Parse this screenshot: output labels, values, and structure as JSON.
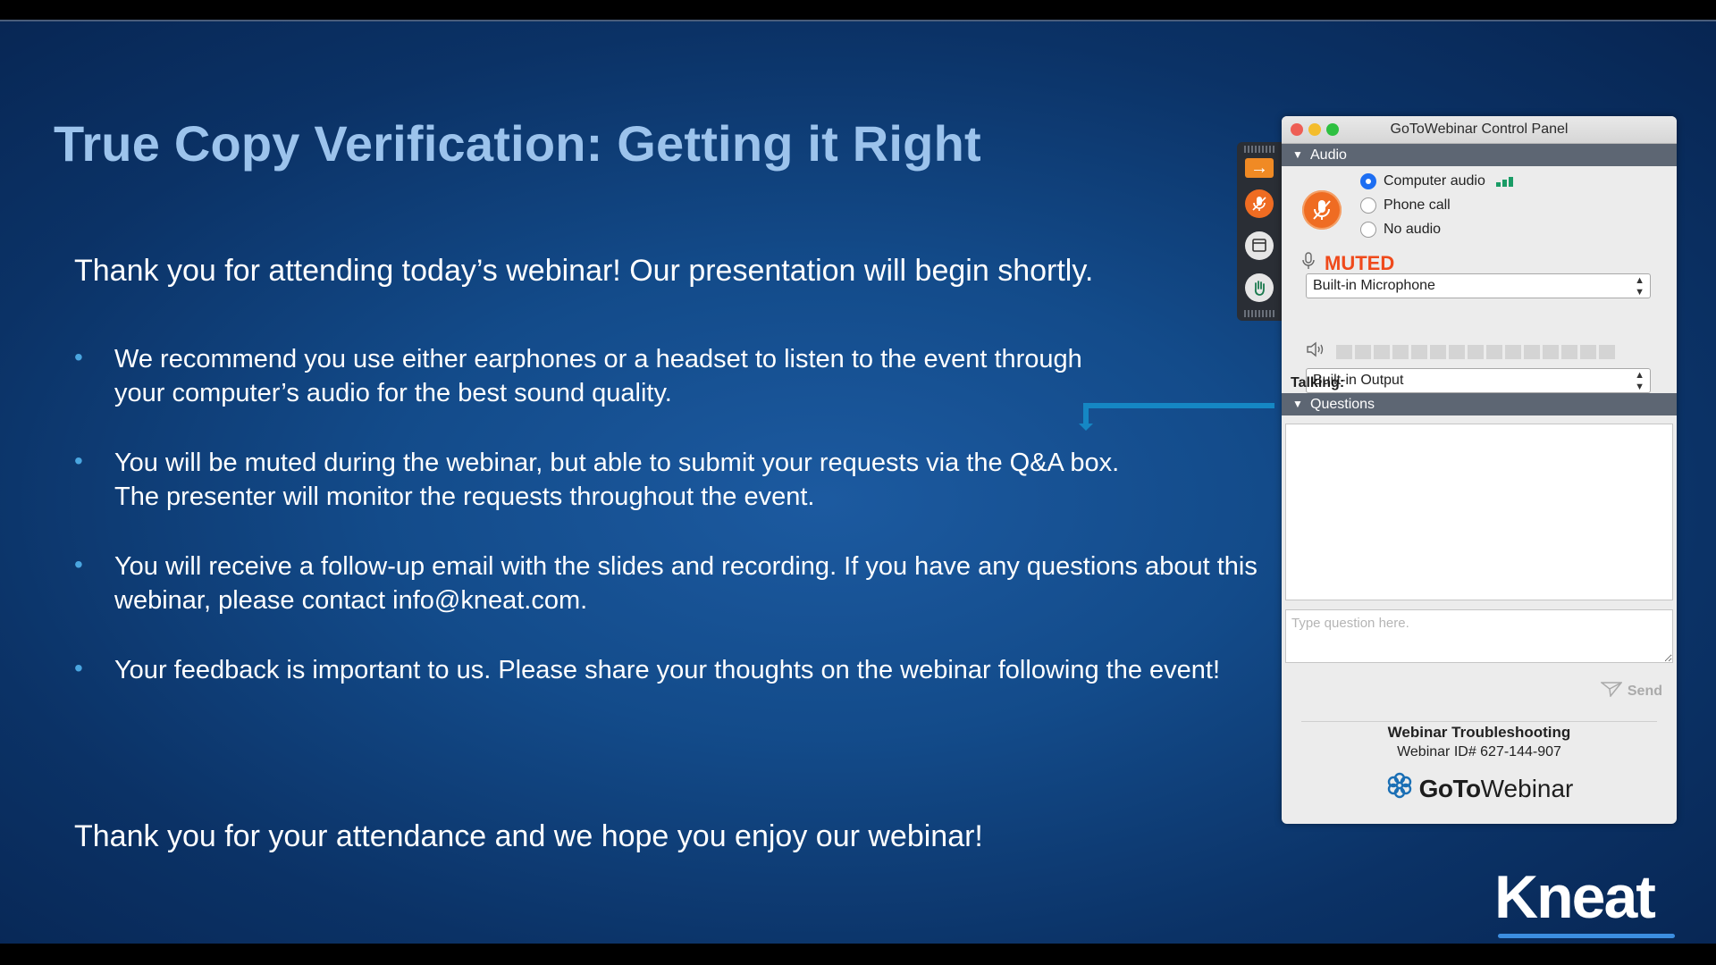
{
  "slide": {
    "title": "True Copy Verification: Getting it Right",
    "intro": "Thank you for attending today’s webinar!  Our presentation will begin shortly.",
    "bullet_marker": "•",
    "bullets": [
      {
        "line1": "We recommend you use either earphones or a headset to listen to the event through",
        "line2": "your computer’s audio for the best sound quality."
      },
      {
        "line1": "You will be muted during the webinar, but able to submit your requests via the Q&A box.",
        "line2": "The presenter will monitor the requests throughout the event."
      },
      {
        "line1": "You will receive a follow-up email with the slides and recording. If you have any questions about this",
        "line2": "webinar, please contact info@kneat.com."
      },
      {
        "line1": "Your feedback is important to us. Please share your thoughts on the webinar following the event!",
        "line2": ""
      }
    ],
    "closing": "Thank you for your attendance and we hope you enjoy our webinar!",
    "logo_text": "Kneat"
  },
  "toolbar": {
    "icons": [
      "arrow-right-icon",
      "microphone-icon",
      "screen-icon",
      "raise-hand-icon"
    ],
    "arrow_glyph": "→"
  },
  "panel": {
    "window_title": "GoToWebinar Control Panel",
    "audio_section": "Audio",
    "audio_options": [
      {
        "label": "Computer audio",
        "selected": true
      },
      {
        "label": "Phone call",
        "selected": false
      },
      {
        "label": "No audio",
        "selected": false
      }
    ],
    "muted_label": "MUTED",
    "microphone_select": "Built-in Microphone",
    "output_select": "Built-in Output",
    "talking_label": "Talking:",
    "questions_section": "Questions",
    "question_placeholder": "Type question here.",
    "send_label": "Send",
    "troubleshooting_title": "Webinar Troubleshooting",
    "webinar_id": "Webinar ID# 627-144-907",
    "brand_goto": "GoTo",
    "brand_webinar": "Webinar",
    "triangle_glyph": "▼"
  },
  "colors": {
    "title": "#9cc3ec",
    "accent_orange": "#ef6c22",
    "muted_red": "#ef4a1c",
    "connector": "#1587c4",
    "section_header": "#5d6673"
  }
}
